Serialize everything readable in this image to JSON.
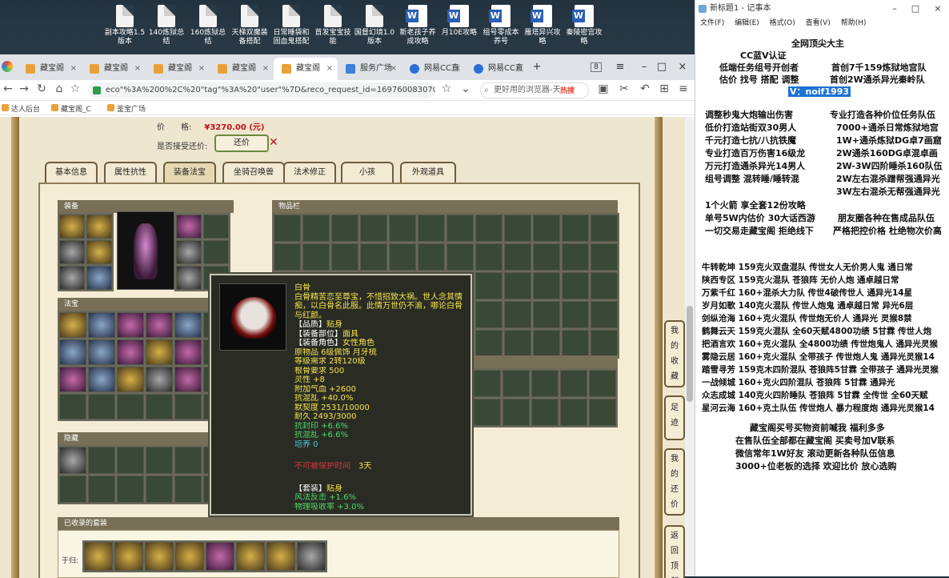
{
  "desktop": {
    "icons": [
      {
        "label": "副本攻略1.5版本",
        "kind": "doc"
      },
      {
        "label": "140炼狱总结",
        "kind": "doc"
      },
      {
        "label": "160炼狱总结",
        "kind": "doc"
      },
      {
        "label": "天梯双魔装备搭配",
        "kind": "doc"
      },
      {
        "label": "日常睡袋和固血鬼搭配",
        "kind": "doc"
      },
      {
        "label": "首发宝宝技能",
        "kind": "doc"
      },
      {
        "label": "国督幻境1.0版本",
        "kind": "doc"
      },
      {
        "label": "新老孩子养成攻略",
        "kind": "word"
      },
      {
        "label": "月10E攻略",
        "kind": "word"
      },
      {
        "label": "组号零成本养号",
        "kind": "word"
      },
      {
        "label": "雁塔异兴攻略",
        "kind": "word"
      },
      {
        "label": "秦陵密宫攻略",
        "kind": "word"
      }
    ]
  },
  "browser": {
    "tabs": [
      {
        "label": "藏宝阁"
      },
      {
        "label": "藏宝阁"
      },
      {
        "label": "藏宝阁"
      },
      {
        "label": "藏宝阁"
      },
      {
        "label": "藏宝阁"
      },
      {
        "label": "服务广场"
      },
      {
        "label": "网易CC直"
      },
      {
        "label": "网易CC直"
      }
    ],
    "tab_count": "8",
    "url": "eco\"%3A%200%2C%20\"tag\"%3A%20\"user\"%7D&reco_request_id=1697600830702_4qhi",
    "search_placeholder": "更好用的浏览器-天",
    "search_hot": "热搜",
    "bookmarks": [
      "达人后台",
      "藏宝阁_C",
      "鉴宝广场"
    ]
  },
  "listing": {
    "price_label": "价　　格:",
    "price_value": "¥3270.00 (元)",
    "bargain_label": "是否接受还价:",
    "bargain_button": "还价",
    "tabs": [
      "基本信息",
      "属性抗性",
      "装备法宝",
      "坐骑召唤兽",
      "法术修正",
      "小孩",
      "外观道具"
    ],
    "sections": {
      "equipment": "装备",
      "inventory": "物品栏",
      "magic": "法宝",
      "hidden": "隐藏",
      "suits": "已收录的套装",
      "suits_row": "于归:"
    },
    "side_buttons": [
      "我的收藏",
      "足迹",
      "我的还价",
      "返回顶部"
    ]
  },
  "tooltip": {
    "name": "白骨",
    "desc": "白骨精苦恋至尊宝，不惜招致大祸。世人念其情痴，以白骨名此服。此情万世仍不渝，哪论白骨与红颜。",
    "quality_label": "【品质】",
    "quality": "贴身",
    "slot_label": "【装备部位】",
    "slot": "面具",
    "role_label": "【装备角色】",
    "role": "女性角色",
    "lines_yellow": [
      "原物品 6级佩饰 月牙梳",
      "等级需求 2转120级",
      "根骨要求 500",
      "灵性 +8",
      "附加气血 +2600",
      "抗混乱 +40.0%",
      "默契度 2531/10000",
      "耐久 2493/3000"
    ],
    "lines_green": [
      "抗封印 +6.6%",
      "抗混乱 +6.6%"
    ],
    "line_cyan": "培养 0",
    "protect_label": "不可被保护时间",
    "protect_days": "3天",
    "suit_label": "【套装】",
    "suit": "贴身",
    "suit_lines": [
      "风法反击 +1.6%",
      "物理吸收率 +3.0%"
    ]
  },
  "notepad": {
    "title": "新标题1 - 记事本",
    "menu": [
      "文件(F)",
      "编辑(E)",
      "格式(O)",
      "查看(V)",
      "帮助(H)"
    ],
    "lines": [
      "全网顶尖大主",
      "CC蓝V认证",
      "低端任务组号开创者",
      "首创7千159炼狱地宫队",
      "估价 找号 搭配 调整",
      "首创2W通杀异光秦岭队",
      "V：noif1993",
      "调整秒鬼大炮输出伤害",
      "专业打造各种价位任务队伍",
      "低价打造站街双30男人",
      "7000+通杀日常炼狱地宫",
      "千元打造七抗/八抗铁魔",
      "1W+通杀炼狱DG卓7画窟",
      "专业打造百万伤害16级龙",
      "2W通杀160DG卓混卓画",
      "万元打造通杀异光14男人",
      "2W-3W四阶睡杀160队伍",
      "组号调整 混转睡/睡转混",
      "2W左右混杀蹭帮强通异光",
      "3W左右混杀无帮强通异光",
      "1个火箭 享全套12份攻略",
      "单号5W内估价 30大话西游",
      "朋友圈各种在售成品队伍",
      "一切交易走藏宝阁 拒绝线下",
      "严格把控价格 杜绝物次价高",
      "牛转乾坤 159克火双盘混队 传世女人无价男人鬼 通日常",
      "陕西专区 159克火混队 苍狼阵 无价人炮 通卓越日常",
      "万紫千红 160+混杀大力队 传世4破传世人 通异光14星",
      "岁月如歌 140克火混队 传世人炮鬼 通卓越日常 异光6层",
      "剑纵沧海 160+克火混队 传世炮无价人 通异光 灵猴8禁",
      "鹤舞云天 159克火混队 全60天赋4800功绩 5甘霖 传世人炮",
      "把酒言欢 160+克火混队 全4800功绩 传世炮鬼人 通异光灵猴",
      "雾隐云居 160+克火混队 全带孩子 传世炮人鬼 通异光灵猴14",
      "踏雪寻芳 159克木四阶混队 苍狼阵5甘霖 全带孩子 通异光灵猴",
      "一战倾城 160+克火四阶混队 苍狼阵 5甘霖 通异光",
      "众志成城 140克火四阶睡队 苍狼阵 5甘霖 全传世 全60天赋",
      "星河云海 160+克土队伍 传世炮人 暴力程度炮 通异光灵猴14",
      "藏宝阁买号买物资前喊我 福利多多",
      "在售队伍全部都在藏宝阁 买卖号加V联系",
      "微信常年1W好友 滚动更新各种队伍信息",
      "3000+位老板的选择 欢迎比价 放心选购"
    ]
  }
}
